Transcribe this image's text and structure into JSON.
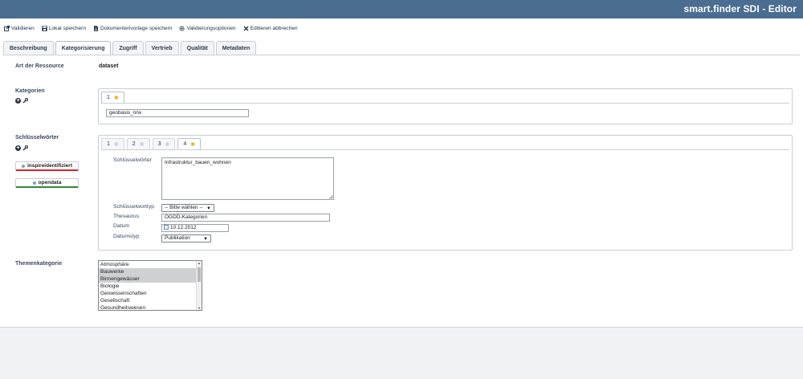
{
  "app": {
    "title": "smart.finder SDI - Editor"
  },
  "toolbar": [
    {
      "label": "Validieren",
      "icon": "external-link-icon"
    },
    {
      "label": "Lokal speichern",
      "icon": "save-icon"
    },
    {
      "label": "Dokumentenvorlage speichern",
      "icon": "document-icon"
    },
    {
      "label": "Validierungsoptionen",
      "icon": "gears-icon"
    },
    {
      "label": "Editieren abbrechen",
      "icon": "close-icon"
    }
  ],
  "tabs": [
    {
      "label": "Beschreibung",
      "active": false
    },
    {
      "label": "Kategorisierung",
      "active": true
    },
    {
      "label": "Zugriff",
      "active": false
    },
    {
      "label": "Vertrieb",
      "active": false
    },
    {
      "label": "Qualität",
      "active": false
    },
    {
      "label": "Metadaten",
      "active": false
    }
  ],
  "resource": {
    "label": "Art der Ressource",
    "value": "dataset"
  },
  "categories": {
    "label": "Kategorien",
    "tabs": [
      "1"
    ],
    "active_tab": "1",
    "value": "geobasis_nrw"
  },
  "keywords": {
    "label": "Schlüsselwörter",
    "tabs": [
      "1",
      "2",
      "3",
      "4"
    ],
    "active_tab": "4",
    "buttons": [
      {
        "label": "inspireidentifiziert",
        "underline_color": "#d9232d"
      },
      {
        "label": "opendata",
        "underline_color": "#2e8b3a"
      }
    ],
    "fields": {
      "keywords_label": "Schlüsselwörter",
      "keywords_value": "Infrastruktur_bauen_wohnen",
      "type_label": "Schlüsselworttyp",
      "type_value": "-- Bitte wählen --",
      "thesaurus_label": "Thesaurus",
      "thesaurus_value": "OGDD-Kategorien",
      "date_label": "Datum",
      "date_value": "10.12.2012",
      "datetype_label": "Datumstyp",
      "datetype_value": "Publikation"
    }
  },
  "topic": {
    "label": "Themenkategorie",
    "options": [
      {
        "label": "Atmosphäre",
        "selected": false
      },
      {
        "label": "Bauwerke",
        "selected": true
      },
      {
        "label": "Binnengewässer",
        "selected": true
      },
      {
        "label": "Biologie",
        "selected": false
      },
      {
        "label": "Geowissenschaften",
        "selected": false
      },
      {
        "label": "Gesellschaft",
        "selected": false
      },
      {
        "label": "Gesundheitswesen",
        "selected": false
      }
    ]
  },
  "colors": {
    "header": "#4a6d91",
    "star_active": "#e8a623",
    "text_dark": "#1e2e44"
  }
}
